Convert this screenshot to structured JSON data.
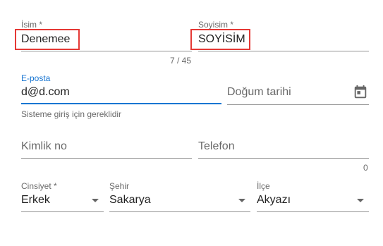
{
  "form": {
    "first_name": {
      "label": "İsim *",
      "value": "Denemee",
      "counter": "7 / 45"
    },
    "last_name": {
      "label": "Soyisim *",
      "value": "SOYİSİM"
    },
    "email": {
      "label": "E-posta",
      "value": "d@d.com",
      "helper": "Sisteme giriş için gereklidir"
    },
    "birth_date": {
      "placeholder": "Doğum tarihi",
      "icon": "calendar-icon"
    },
    "id_number": {
      "placeholder": "Kimlik no"
    },
    "phone": {
      "placeholder": "Telefon",
      "counter": "0"
    },
    "gender": {
      "label": "Cinsiyet *",
      "value": "Erkek"
    },
    "city": {
      "label": "Şehir",
      "value": "Sakarya"
    },
    "district": {
      "label": "İlçe",
      "value": "Akyazı"
    }
  },
  "colors": {
    "focus": "#1976d2",
    "highlight_box": "#e53935"
  }
}
